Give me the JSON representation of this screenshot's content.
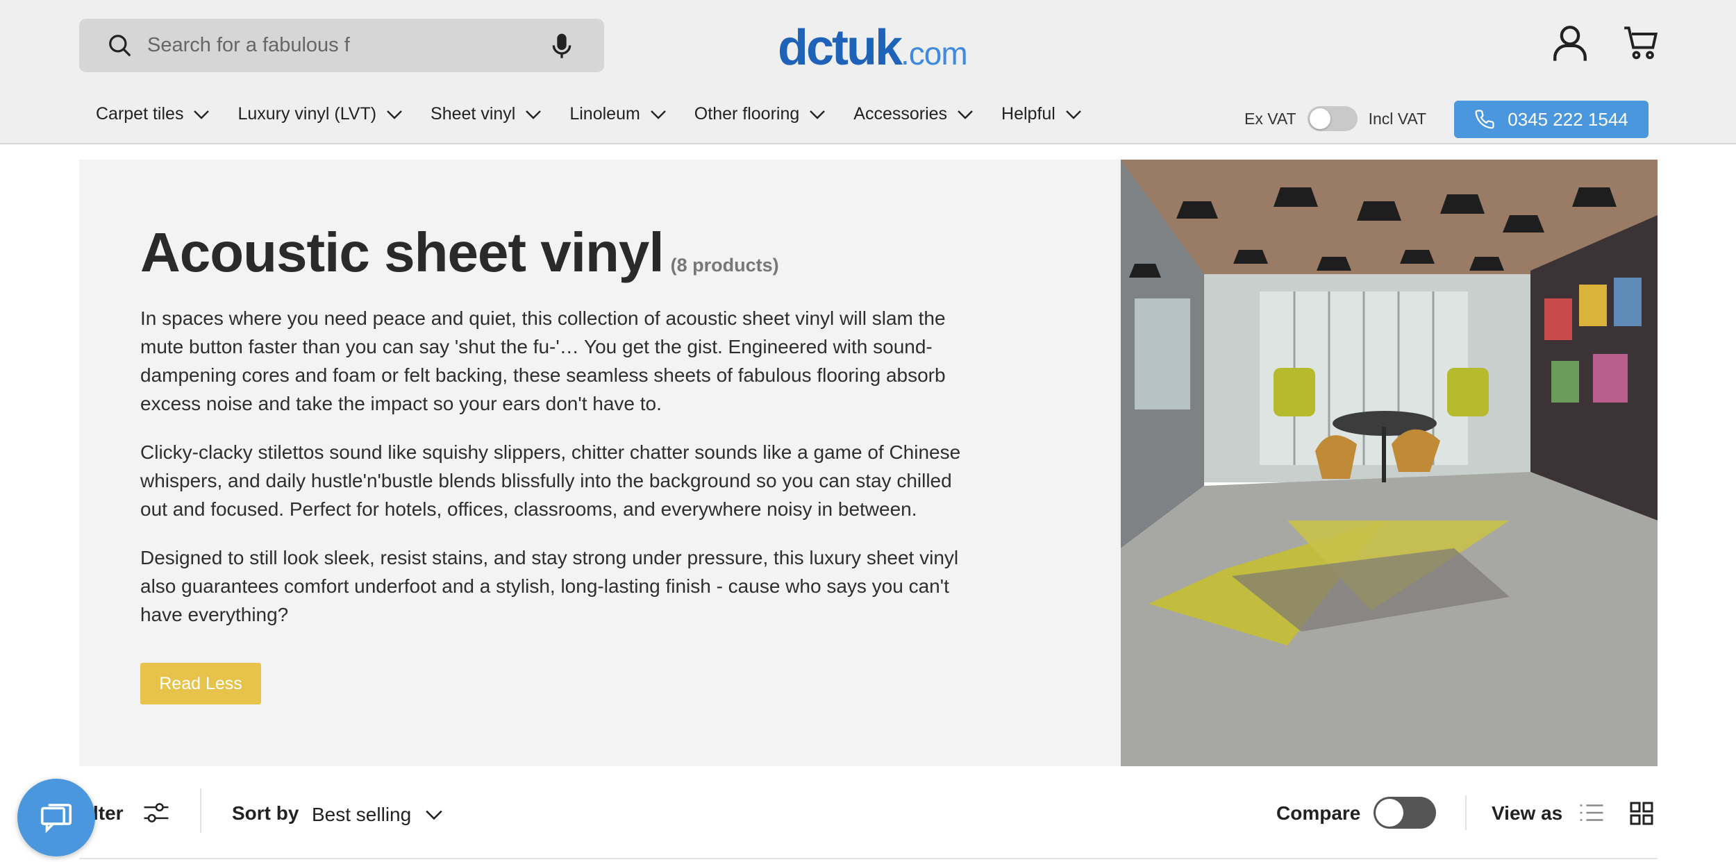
{
  "search": {
    "placeholder": "Search for a fabulous f"
  },
  "logo": {
    "name": "dctuk",
    "domain": ".com"
  },
  "nav": {
    "items": [
      {
        "label": "Carpet tiles"
      },
      {
        "label": "Luxury vinyl (LVT)"
      },
      {
        "label": "Sheet vinyl"
      },
      {
        "label": "Linoleum"
      },
      {
        "label": "Other flooring"
      },
      {
        "label": "Accessories"
      },
      {
        "label": "Helpful"
      }
    ]
  },
  "vat": {
    "ex_label": "Ex VAT",
    "incl_label": "Incl VAT"
  },
  "phone": {
    "number": "0345 222 1544"
  },
  "hero": {
    "title": "Acoustic sheet vinyl",
    "count": "(8 products)",
    "paragraphs": [
      "In spaces where you need peace and quiet, this collection of acoustic sheet vinyl will slam the mute button faster than you can say 'shut the fu-'… You get the gist. Engineered with sound-dampening cores and foam or felt backing, these seamless sheets of fabulous flooring absorb excess noise and take the impact so your ears don't have to.",
      "Clicky-clacky stilettos sound like squishy slippers, chitter chatter sounds like a game of Chinese whispers, and daily hustle'n'bustle blends blissfully into the background so you can stay chilled out and focused. Perfect for hotels, offices, classrooms, and everywhere noisy in between.",
      "Designed to still look sleek, resist stains, and stay strong under pressure, this luxury sheet vinyl also guarantees comfort underfoot and a stylish, long-lasting finish - cause who says you can't have everything?"
    ],
    "read_less": "Read Less"
  },
  "toolbar": {
    "filter": "lter",
    "sort_by": "Sort by",
    "sort_value": "Best selling",
    "compare": "Compare",
    "view_as": "View as"
  },
  "colors": {
    "brand_blue": "#1f63b8",
    "accent_blue": "#4a97de",
    "button_yellow": "#e8c34b"
  },
  "icons": [
    "search-icon",
    "mic-icon",
    "account-icon",
    "cart-icon",
    "chevron-down-icon",
    "phone-icon",
    "filter-sliders-icon",
    "list-view-icon",
    "grid-view-icon",
    "chat-icon"
  ]
}
